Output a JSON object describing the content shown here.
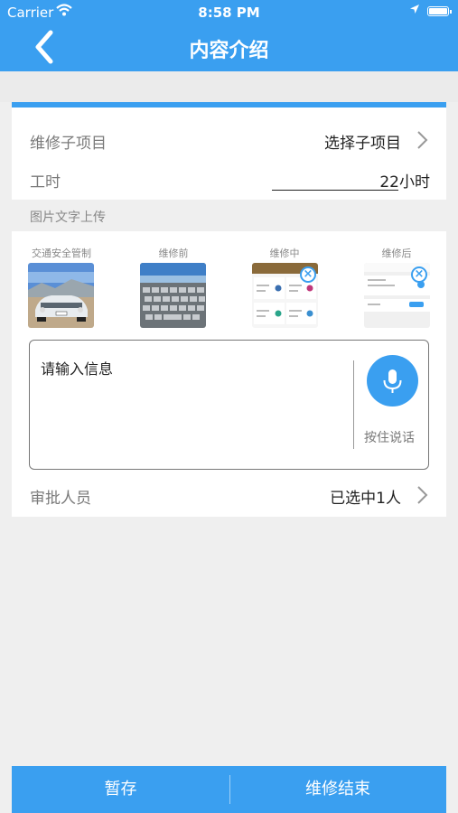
{
  "status_bar": {
    "carrier": "Carrier",
    "time": "8:58 PM"
  },
  "nav": {
    "title": "内容介绍"
  },
  "sub_item": {
    "label": "维修子项目",
    "value": "选择子项目"
  },
  "hours": {
    "label": "工时",
    "value": "22小时"
  },
  "upload": {
    "header": "图片文字上传",
    "images": [
      {
        "label": "交通安全管制",
        "icon": "car-photo"
      },
      {
        "label": "维修前",
        "icon": "keyboard-photo"
      },
      {
        "label": "维修中",
        "icon": "app-screenshot"
      },
      {
        "label": "维修后",
        "icon": "app-screenshot"
      }
    ]
  },
  "message": {
    "placeholder": "请输入信息",
    "voice_label": "按住说话"
  },
  "approver": {
    "label": "审批人员",
    "value": "已选中1人"
  },
  "footer": {
    "save_label": "暂存",
    "finish_label": "维修结束"
  },
  "colors": {
    "accent": "#3a9ff0",
    "background": "#efefef"
  }
}
